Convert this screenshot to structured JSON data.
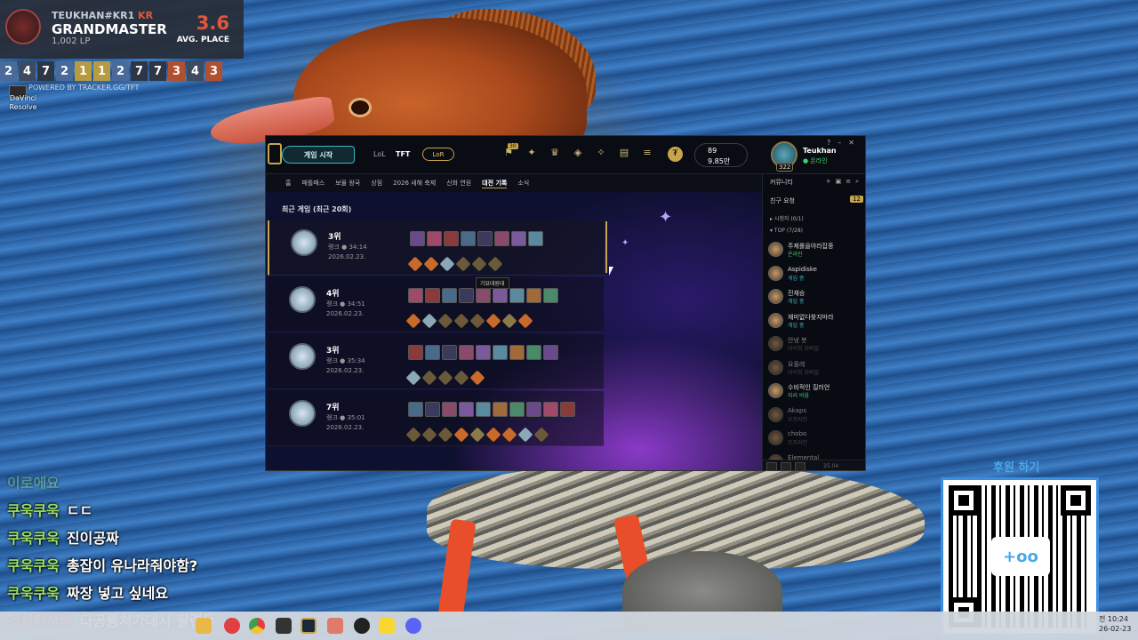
{
  "tracker": {
    "summoner": "TEUKHAN#KR1",
    "region": "KR",
    "rank": "GRANDMASTER",
    "lp": "1,002 LP",
    "avg_place": "3.6",
    "avg_label": "AVG. PLACE",
    "placements": [
      {
        "v": "2",
        "c": "#4a6a9a"
      },
      {
        "v": "4",
        "c": "#3e4a5e"
      },
      {
        "v": "7",
        "c": "#2e3646"
      },
      {
        "v": "2",
        "c": "#4a6a9a"
      },
      {
        "v": "1",
        "c": "#b89a40"
      },
      {
        "v": "1",
        "c": "#b89a40"
      },
      {
        "v": "2",
        "c": "#4a6a9a"
      },
      {
        "v": "7",
        "c": "#2e3646"
      },
      {
        "v": "7",
        "c": "#2e3646"
      },
      {
        "v": "3",
        "c": "#b0502e"
      },
      {
        "v": "4",
        "c": "#3e4a5e"
      },
      {
        "v": "3",
        "c": "#b0502e"
      }
    ],
    "powered": "POWERED BY TRACKER.GG/TFT",
    "desktop_icon_label": "DaVinci Resolve"
  },
  "client": {
    "play_button": "게임 시작",
    "tabs": [
      "LoL",
      "TFT"
    ],
    "lor": "LoR",
    "ticket_badge": "30",
    "rp": "89",
    "be": "9.85만",
    "username": "Teukhan",
    "user_status": "● 온라인",
    "level": "322",
    "subnav": [
      "홈",
      "패틀패스",
      "보물 왕국",
      "상점",
      "2026 새해 축제",
      "신화 연원",
      "대전 기록",
      "소식"
    ],
    "recent_title": "최근 게임 (최근 20회)",
    "matches": [
      {
        "place": "3위",
        "time": "랭크 ● 34:14",
        "date": "2026.02.23."
      },
      {
        "place": "4위",
        "time": "랭크 ● 34:51",
        "date": "2026.02.23."
      },
      {
        "place": "3위",
        "time": "랭크 ● 35:34",
        "date": "2026.02.23."
      },
      {
        "place": "7위",
        "time": "랭크 ● 35:01",
        "date": "2026.02.23."
      }
    ],
    "tooltip": "기묘대원대"
  },
  "social": {
    "header": "커뮤니티",
    "friend_requests": "친구 요청",
    "request_count": "12",
    "group_ingame": "▸ 시청자 (0/1)",
    "group_top": "▾ TOP (7/28)",
    "friends": [
      {
        "name": "주제롤을야라잡중",
        "status": "온라인",
        "kind": "online"
      },
      {
        "name": "Aspidiske",
        "status": "게임 중",
        "kind": "ingame"
      },
      {
        "name": "진재승",
        "status": "게임 중",
        "kind": "ingame"
      },
      {
        "name": "재미없다찾지마라",
        "status": "게임 중",
        "kind": "ingame"
      },
      {
        "name": "안녕 봇",
        "status": "라이엇 모바일",
        "kind": "off"
      },
      {
        "name": "요플레",
        "status": "라이엇 모바일",
        "kind": "off"
      },
      {
        "name": "수비적인 질러언",
        "status": "자리 비움",
        "kind": "online"
      },
      {
        "name": "Akaps",
        "status": "오프라인",
        "kind": "off"
      },
      {
        "name": "chobo",
        "status": "오프라인",
        "kind": "off"
      },
      {
        "name": "Elemental",
        "status": "오프라인",
        "kind": "off"
      }
    ],
    "version": "25.04"
  },
  "chat": [
    {
      "nick": "이로에요",
      "msg": "",
      "faded": true
    },
    {
      "nick": "쿠욱쿠욱",
      "msg": "ㄷㄷ"
    },
    {
      "nick": "쿠욱쿠욱",
      "msg": "진이공짜"
    },
    {
      "nick": "쿠욱쿠욱",
      "msg": "총잡이 유나라줘야함?"
    },
    {
      "nick": "쿠욱쿠욱",
      "msg": "짜장 넣고 싶네요"
    },
    {
      "nick": "건실한사람",
      "msg": "다공룡처가데시 팔련들",
      "alt": true
    }
  ],
  "donate": {
    "title": "후원 하기",
    "logo": "+oo"
  },
  "taskbar": {
    "time": "전 10:24",
    "date": "26-02-23"
  }
}
